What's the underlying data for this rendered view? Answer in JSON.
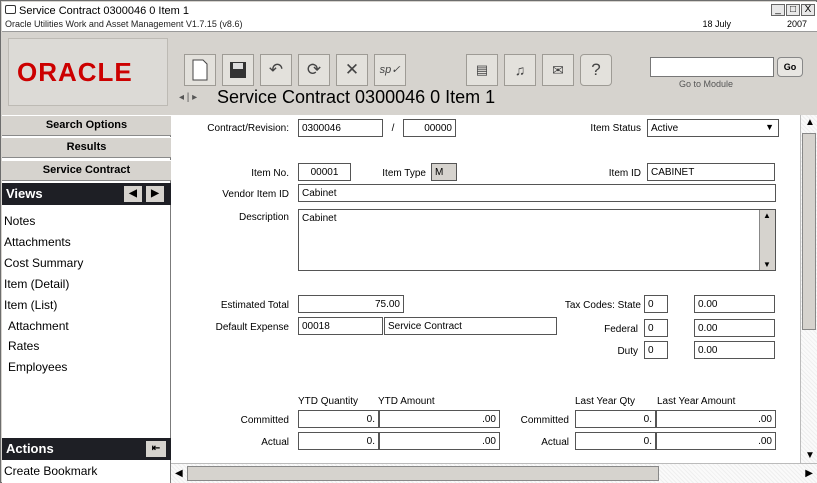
{
  "window": {
    "title": "Service Contract 0300046 0 Item 1",
    "subtitle": "Oracle Utilities Work and Asset Management V1.7.15 (v8.6)",
    "date": "18 July",
    "year": "2007",
    "min_label": "_",
    "max_label": "□",
    "close_label": "X"
  },
  "toolbar": {
    "logo": "ORACLE",
    "page_title": "Service Contract 0300046 0 Item 1",
    "module_placeholder": "",
    "module_label": "Go to Module",
    "go_label": "Go",
    "nav_arrows": "◂ | ▸",
    "icons": [
      "new-icon",
      "save-icon",
      "undo-icon",
      "refresh-icon",
      "delete-icon",
      "spell-check-icon",
      "report-icon",
      "bell-icon",
      "mail-icon",
      "help-icon"
    ]
  },
  "sidebar": {
    "search_options": "Search Options",
    "results": "Results",
    "service_contract": "Service Contract",
    "views_header": "Views",
    "views": [
      "Notes",
      "Attachments",
      "Cost Summary",
      "Item (Detail)",
      "Item (List)"
    ],
    "subviews": [
      "Attachment",
      "Rates",
      "Employees"
    ],
    "actions_header": "Actions",
    "actions": [
      "Create Bookmark"
    ]
  },
  "form": {
    "contract_label": "Contract/Revision:",
    "contract": "0300046",
    "slash": "/",
    "revision": "00000",
    "item_status_label": "Item Status",
    "item_status": "Active",
    "item_no_label": "Item No.",
    "item_no": "00001",
    "item_type_label": "Item Type",
    "item_type": "M",
    "item_id_label": "Item ID",
    "item_id": "CABINET",
    "vendor_item_label": "Vendor Item ID",
    "vendor_item": "Cabinet",
    "description_label": "Description",
    "description": "Cabinet",
    "estimated_total_label": "Estimated Total",
    "estimated_total": "75.00",
    "default_expense_label": "Default Expense",
    "default_expense_code": "00018",
    "default_expense_name": "Service Contract",
    "tax_codes_label": "Tax Codes:  State",
    "state_code": "0",
    "state_rate": "0.00",
    "federal_label": "Federal",
    "federal_code": "0",
    "federal_rate": "0.00",
    "duty_label": "Duty",
    "duty_code": "0",
    "duty_rate": "0.00",
    "ytd_qty_label": "YTD Quantity",
    "ytd_amt_label": "YTD Amount",
    "last_qty_label": "Last Year Qty",
    "last_amt_label": "Last Year Amount",
    "committed_label": "Committed",
    "actual_label": "Actual",
    "ytd_committed_qty": "0.",
    "ytd_committed_amt": ".00",
    "ytd_actual_qty": "0.",
    "ytd_actual_amt": ".00",
    "ly_committed_qty": "0.",
    "ly_committed_amt": ".00",
    "ly_actual_qty": "0.",
    "ly_actual_amt": ".00"
  }
}
